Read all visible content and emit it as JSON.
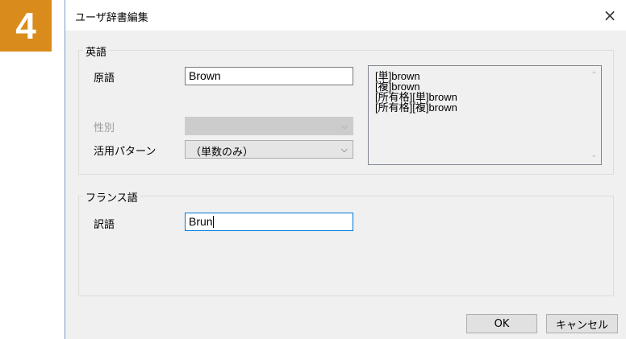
{
  "step_badge": "4",
  "dialog": {
    "title": "ユーザ辞書編集",
    "close_symbol": "×"
  },
  "english_group": {
    "label": "英語",
    "source_label": "原語",
    "source_value": "Brown",
    "gender_label": "性別",
    "gender_value": "",
    "pattern_label": "活用パターン",
    "pattern_value": "（単数のみ）",
    "forms": [
      "[単]brown",
      "[複]brown",
      "[所有格][単]brown",
      "[所有格][複]brown"
    ]
  },
  "french_group": {
    "label": "フランス語",
    "translation_label": "訳語",
    "translation_value": "Brun"
  },
  "buttons": {
    "ok": "OK",
    "cancel": "キャンセル"
  },
  "colors": {
    "badge": "#d98c1c",
    "focus_border": "#0078d7",
    "dialog_bg": "#f0f0f0"
  },
  "icons": {
    "dropdown_arrow": "⌵",
    "scroll_up": "⌃",
    "scroll_down": "⌄"
  }
}
